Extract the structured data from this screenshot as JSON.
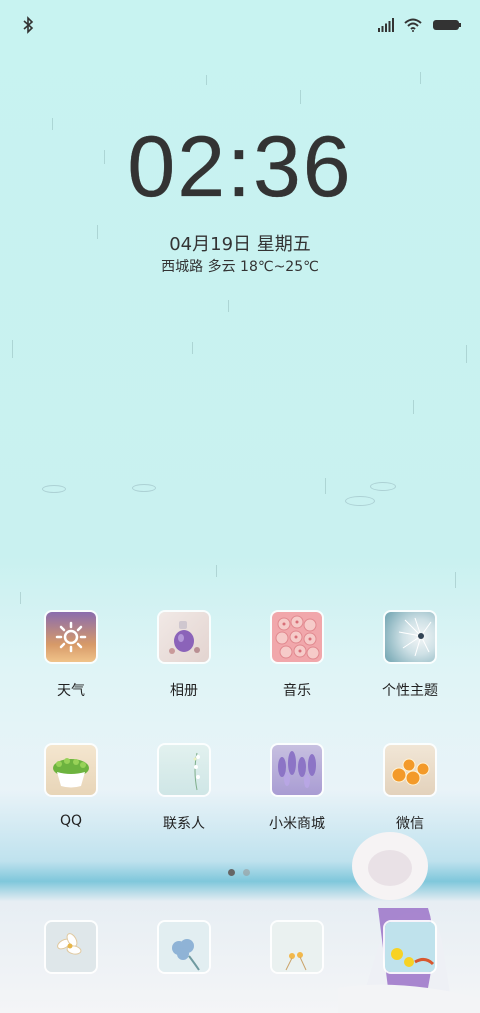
{
  "status_bar": {
    "left_icon": "bluetooth-icon",
    "right_icons": [
      "signal-icon",
      "wifi-icon",
      "battery-icon"
    ]
  },
  "lockscreen": {
    "time": "02:36",
    "date": "04月19日  星期五",
    "weather": "西城路 多云 18℃~25℃"
  },
  "apps_row1": [
    {
      "label": "天气",
      "icon": "weather-icon"
    },
    {
      "label": "相册",
      "icon": "gallery-icon"
    },
    {
      "label": "音乐",
      "icon": "music-icon"
    },
    {
      "label": "个性主题",
      "icon": "themes-icon"
    }
  ],
  "apps_row2": [
    {
      "label": "QQ",
      "icon": "qq-icon"
    },
    {
      "label": "联系人",
      "icon": "contacts-icon"
    },
    {
      "label": "小米商城",
      "icon": "mi-store-icon"
    },
    {
      "label": "微信",
      "icon": "wechat-icon"
    }
  ],
  "dock": [
    "phone-icon",
    "messages-icon",
    "browser-icon",
    "camera-icon"
  ],
  "page_indicator": {
    "current": 1,
    "total": 2
  }
}
